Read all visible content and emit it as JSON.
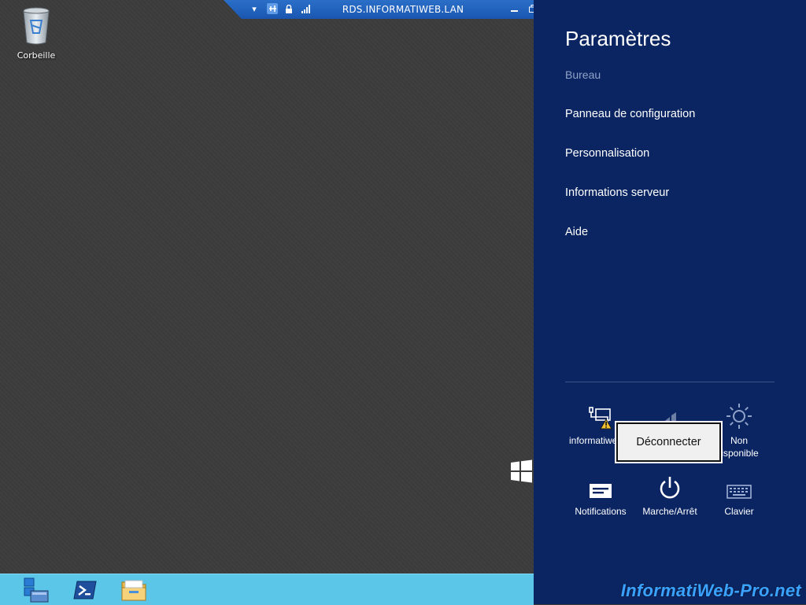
{
  "desktop": {
    "recycle_bin_label": "Corbeille"
  },
  "rdp_bar": {
    "title": "RDS.INFORMATIWEB.LAN",
    "icons": [
      "dropdown-icon",
      "pin-icon",
      "lock-icon",
      "signal-icon",
      "minimize-icon",
      "restore-icon",
      "close-icon"
    ]
  },
  "settings": {
    "heading": "Paramètres",
    "context": "Bureau",
    "items": [
      {
        "label": "Panneau de configuration"
      },
      {
        "label": "Personnalisation"
      },
      {
        "label": "Informations serveur"
      },
      {
        "label": "Aide"
      }
    ],
    "tiles": {
      "network": {
        "label": "informatiwe",
        "icon": "network-warning-icon"
      },
      "volume": {
        "label": "",
        "icon": "volume-icon"
      },
      "brightness": {
        "label": "Non disponible",
        "label_line1": "Non",
        "label_line2": "isponible",
        "icon": "brightness-icon"
      },
      "notifications": {
        "label": "Notifications",
        "icon": "notifications-icon"
      },
      "power": {
        "label": "Marche/Arrêt",
        "icon": "power-icon"
      },
      "keyboard": {
        "label": "Clavier",
        "icon": "keyboard-icon"
      }
    },
    "popup": {
      "label": "Déconnecter"
    }
  },
  "taskbar": {
    "apps": [
      {
        "name": "server-manager-icon"
      },
      {
        "name": "powershell-icon"
      },
      {
        "name": "file-explorer-icon"
      }
    ]
  },
  "watermark": "InformatiWeb-Pro.net",
  "colors": {
    "charms_bg": "#0b2563",
    "taskbar_bg": "#5cc6e8",
    "desktop_bg": "#3c3c3c",
    "rdp_bar_bg": "#1a56b0"
  }
}
